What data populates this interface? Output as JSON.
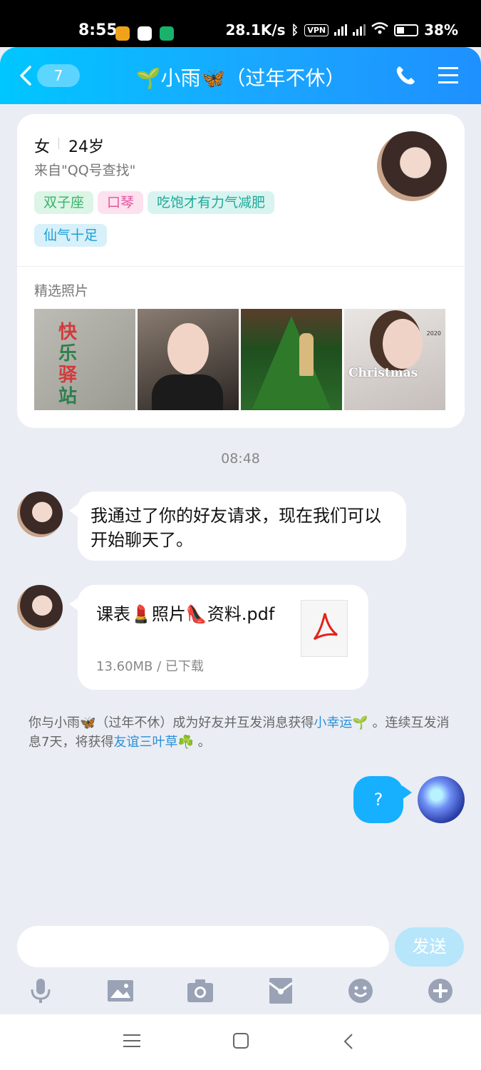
{
  "status_bar": {
    "time": "8:55",
    "network_speed": "28.1K/s",
    "vpn": "VPN",
    "battery": "38%"
  },
  "header": {
    "back_count": "7",
    "title": "🌱小雨🦋（过年不休）"
  },
  "profile": {
    "gender": "女",
    "age": "24岁",
    "source": "来自\"QQ号查找\"",
    "tags": [
      "双子座",
      "口琴",
      "吃饱才有力气减肥",
      "仙气十足"
    ],
    "photos_label": "精选照片",
    "photos": [
      {
        "name": "photo-1",
        "text_lines": [
          "快",
          "乐",
          "驿",
          "站"
        ]
      },
      {
        "name": "photo-2"
      },
      {
        "name": "photo-3"
      },
      {
        "name": "photo-4",
        "caption": "Christmas",
        "year": "2020"
      }
    ]
  },
  "chat": {
    "timestamp": "08:48",
    "messages": [
      {
        "from": "other",
        "type": "text",
        "text": "我通过了你的好友请求，现在我们可以开始聊天了。"
      },
      {
        "from": "other",
        "type": "file",
        "file_name": "课表💄照片👠资料.pdf",
        "file_meta": "13.60MB / 已下载",
        "icon": "pdf-icon"
      }
    ],
    "system_message": {
      "part1": "你与小雨🦋（过年不休）成为好友并互发消息获得",
      "link1": "小幸运",
      "part2": "🌱 。连续互发消息7天，将获得",
      "link2": "友谊三叶草",
      "part3": "☘️ 。"
    },
    "my_message": "?"
  },
  "input": {
    "placeholder": "",
    "send_label": "发送"
  },
  "toolbar": [
    "microphone-icon",
    "image-icon",
    "camera-icon",
    "red-packet-icon",
    "emoji-icon",
    "plus-icon"
  ],
  "colors": {
    "header_start": "#00c6ff",
    "header_end": "#1e90ff",
    "my_bubble": "#17b0ff",
    "link": "#2b8fd6",
    "send_disabled": "#b7e6fb"
  }
}
